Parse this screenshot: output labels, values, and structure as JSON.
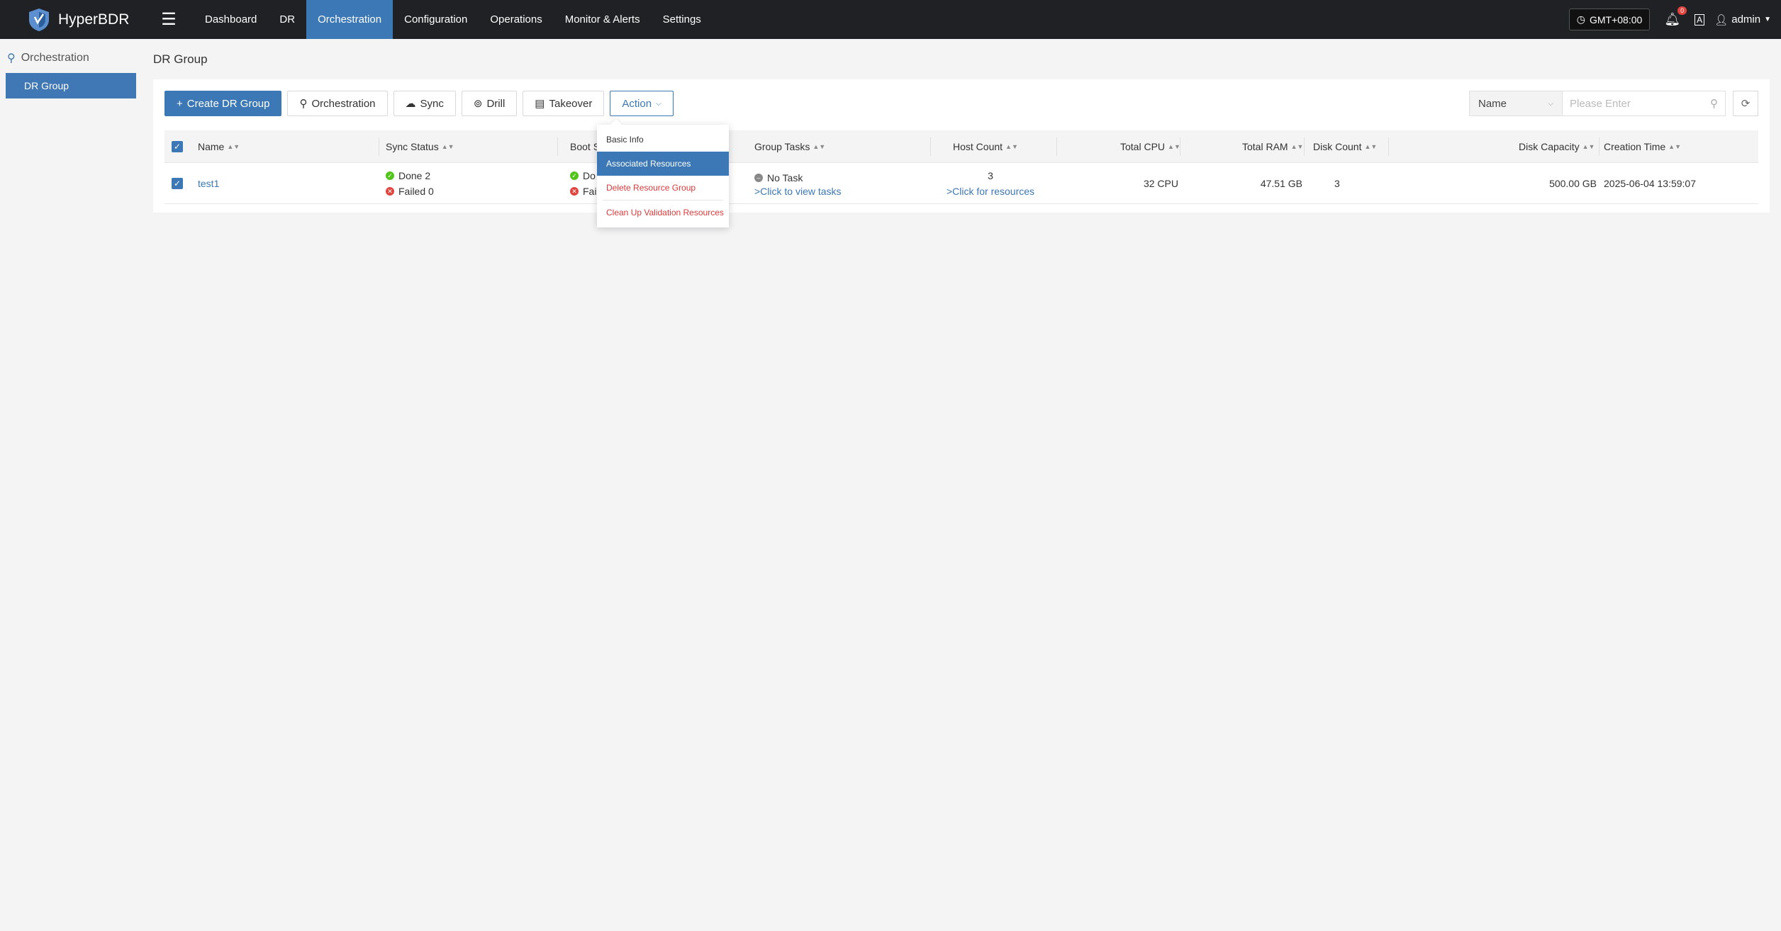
{
  "app": {
    "name": "HyperBDR"
  },
  "topnav": {
    "items": [
      {
        "label": "Dashboard",
        "active": false
      },
      {
        "label": "DR",
        "active": false
      },
      {
        "label": "Orchestration",
        "active": true
      },
      {
        "label": "Configuration",
        "active": false
      },
      {
        "label": "Operations",
        "active": false
      },
      {
        "label": "Monitor & Alerts",
        "active": false
      },
      {
        "label": "Settings",
        "active": false
      }
    ],
    "timezone": "GMT+08:00",
    "notification_count": "0",
    "lang_label": "A",
    "user": "admin"
  },
  "sidebar": {
    "section": "Orchestration",
    "items": [
      {
        "label": "DR Group",
        "active": true
      }
    ]
  },
  "page": {
    "title": "DR Group"
  },
  "toolbar": {
    "create": "Create DR Group",
    "orchestration": "Orchestration",
    "sync": "Sync",
    "drill": "Drill",
    "takeover": "Takeover",
    "action": "Action"
  },
  "search": {
    "field": "Name",
    "placeholder": "Please Enter"
  },
  "table": {
    "headers": {
      "name": "Name",
      "sync_status": "Sync Status",
      "boot_status": "Boot S",
      "group_tasks": "Group Tasks",
      "host_count": "Host Count",
      "total_cpu": "Total CPU",
      "total_ram": "Total RAM",
      "disk_count": "Disk Count",
      "disk_capacity": "Disk Capacity",
      "creation_time": "Creation Time"
    },
    "rows": [
      {
        "name": "test1",
        "sync_done": "Done 2",
        "sync_failed": "Failed 0",
        "boot_done": "Do",
        "boot_failed": "Fail",
        "task_status": "No Task",
        "task_link": ">Click to view tasks",
        "host_count": "3",
        "host_link": ">Click for resources",
        "total_cpu": "32 CPU",
        "total_ram": "47.51 GB",
        "disk_count": "3",
        "disk_capacity": "500.00 GB",
        "creation_time": "2025-06-04 13:59:07"
      }
    ]
  },
  "action_menu": {
    "items": [
      {
        "label": "Basic Info",
        "style": "normal"
      },
      {
        "label": "Associated Resources",
        "style": "selected"
      },
      {
        "label": "Delete Resource Group",
        "style": "danger"
      },
      {
        "label": "Clean Up Validation Resources",
        "style": "danger"
      }
    ]
  },
  "colors": {
    "brand": "#3b78b5",
    "topbar": "#202124",
    "success": "#52c41a",
    "danger": "#e0443e"
  }
}
